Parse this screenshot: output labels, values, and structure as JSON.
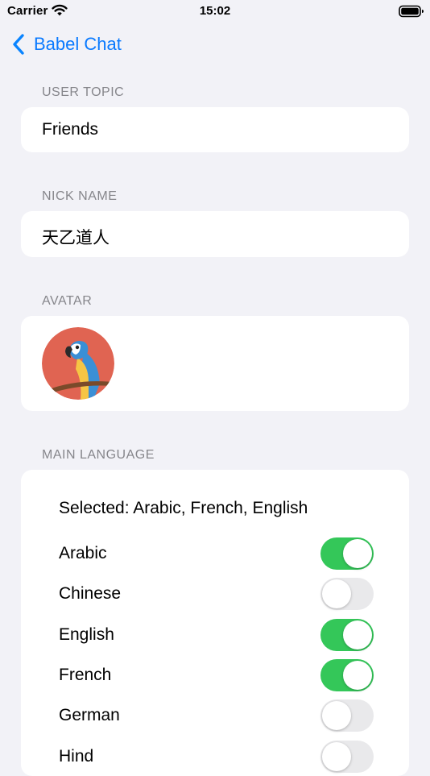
{
  "status_bar": {
    "carrier": "Carrier",
    "time": "15:02"
  },
  "nav": {
    "back_label": "Babel Chat"
  },
  "user_topic": {
    "header": "USER TOPIC",
    "value": "Friends"
  },
  "nick_name": {
    "header": "NICK NAME",
    "value": "天乙道人"
  },
  "avatar": {
    "header": "AVATAR",
    "image": "parrot-avatar"
  },
  "main_language": {
    "header": "MAIN LANGUAGE",
    "selected_text": "Selected: Arabic, French, English",
    "languages": [
      {
        "label": "Arabic",
        "on": true
      },
      {
        "label": "Chinese",
        "on": false
      },
      {
        "label": "English",
        "on": true
      },
      {
        "label": "French",
        "on": true
      },
      {
        "label": "German",
        "on": false
      },
      {
        "label": "Hind",
        "on": false
      }
    ]
  },
  "colors": {
    "accent": "#0a84ff",
    "toggle_on": "#34c759",
    "toggle_off": "#e9e9eb",
    "background": "#f2f2f7"
  }
}
